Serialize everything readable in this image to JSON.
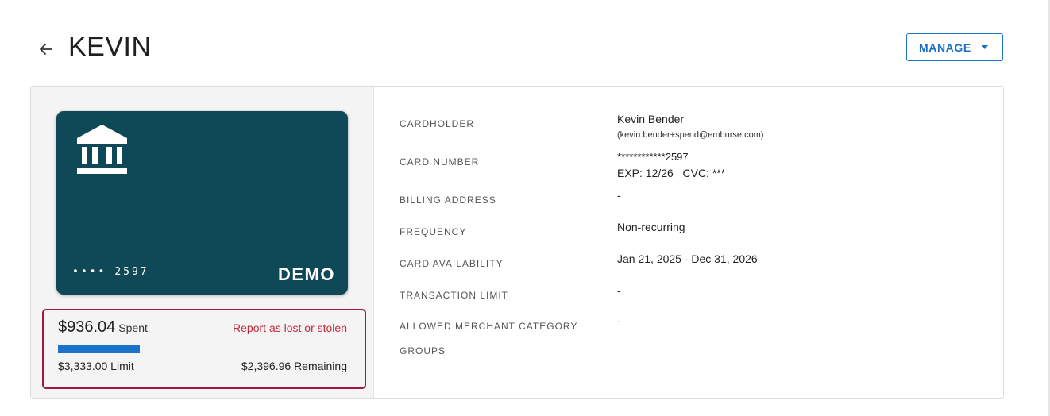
{
  "header": {
    "title": "KEVIN",
    "manage_label": "MANAGE"
  },
  "card": {
    "mask_dots": "••••",
    "last_four": "2597",
    "demo_label": "DEMO",
    "background_color": "#0f4856"
  },
  "spend": {
    "spent_amount": "$936.04",
    "spent_label": "Spent",
    "report_link": "Report as lost or stolen",
    "limit_text": "$3,333.00 Limit",
    "remaining_text": "$2,396.96 Remaining",
    "spent_fraction": 0.281,
    "progress_color": "#1a73c8",
    "box_border_color": "#a31647"
  },
  "details": {
    "cardholder_label": "CARDHOLDER",
    "cardholder_name": "Kevin Bender",
    "cardholder_email": "(kevin.bender+spend@emburse.com)",
    "card_number_label": "CARD NUMBER",
    "card_number_value": "************2597",
    "card_exp_cvc": "EXP: 12/26   CVC: ***",
    "billing_address_label": "BILLING ADDRESS",
    "billing_address_value": "-",
    "frequency_label": "FREQUENCY",
    "frequency_value": "Non-recurring",
    "availability_label": "CARD AVAILABILITY",
    "availability_value": "Jan 21, 2025 - Dec 31, 2026",
    "transaction_limit_label": "TRANSACTION LIMIT",
    "transaction_limit_value": "-",
    "mcc_label": "ALLOWED MERCHANT CATEGORY GROUPS",
    "mcc_value": "-"
  },
  "icons": {
    "back": "arrow-left-icon",
    "bank": "bank-icon",
    "caret": "caret-down-icon"
  }
}
